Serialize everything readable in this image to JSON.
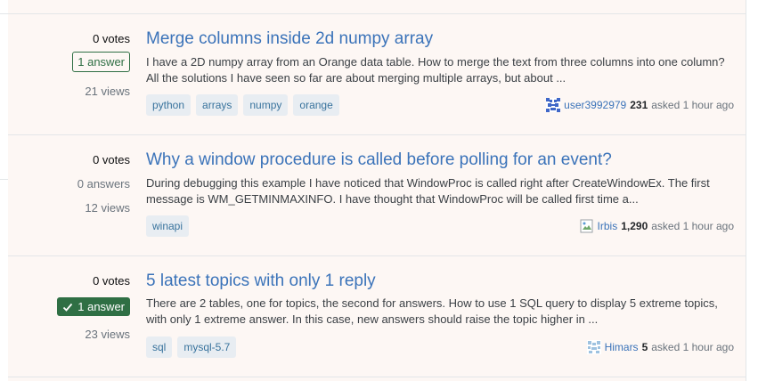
{
  "questions": [
    {
      "votes": "0 votes",
      "answers": "1 answer",
      "answer_state": "has-answer",
      "views": "21 views",
      "title": "Merge columns inside 2d numpy array",
      "excerpt": "I have a 2D numpy array from an Orange data table. How to merge the text from three columns into one column? All the solutions I have seen so far are about merging multiple arrays, but about ...",
      "tags": [
        "python",
        "arrays",
        "numpy",
        "orange"
      ],
      "user": "user3992979",
      "reputation": "231",
      "asked": "asked 1 hour ago",
      "avatar_icon": "identicon-blue"
    },
    {
      "votes": "0 votes",
      "answers": "0 answers",
      "answer_state": "none",
      "views": "12 views",
      "title": "Why a window procedure is called before polling for an event?",
      "excerpt": "During debugging this example I have noticed that WindowProc is called right after CreateWindowEx. The first message is WM_GETMINMAXINFO. I have thought that WindowProc will be called first time a...",
      "tags": [
        "winapi"
      ],
      "user": "Irbis",
      "reputation": "1,290",
      "asked": "asked 1 hour ago",
      "avatar_icon": "broken-image"
    },
    {
      "votes": "0 votes",
      "answers": "1 answer",
      "answer_state": "accepted",
      "views": "23 views",
      "title": "5 latest topics with only 1 reply",
      "excerpt": "There are 2 tables, one for topics, the second for answers. How to use 1 SQL query to display 5 extreme topics, with only 1 extreme answer. In this case, new answers should raise the topic higher in ...",
      "tags": [
        "sql",
        "mysql-5.7"
      ],
      "user": "Himars",
      "reputation": "5",
      "asked": "asked 1 hour ago",
      "avatar_icon": "identicon-light"
    }
  ],
  "colors": {
    "background": "#fdf7f4",
    "title_link": "#3b73b9",
    "answer_green": "#2f6f44",
    "tag_bg": "#e8edf2",
    "tag_text": "#39739d"
  }
}
